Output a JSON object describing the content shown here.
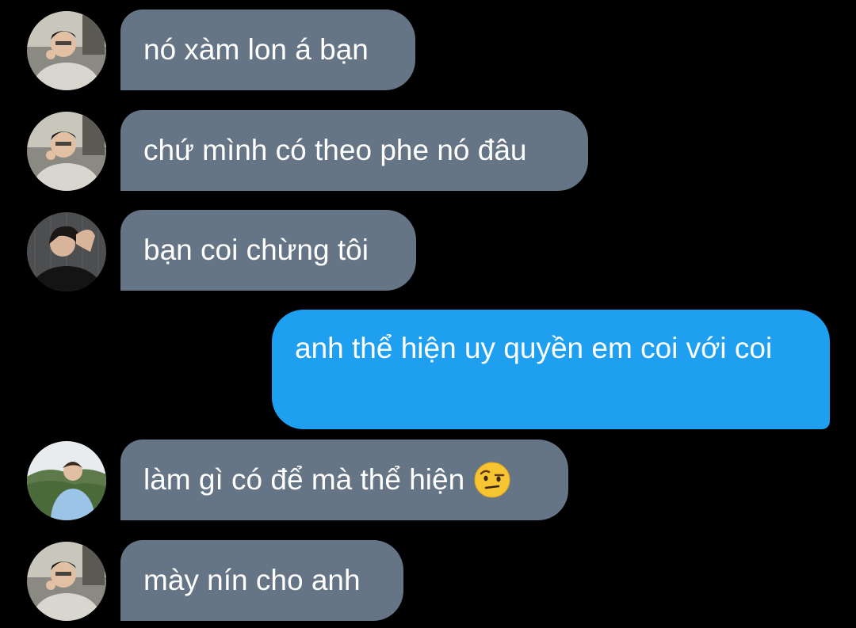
{
  "messages": [
    {
      "sender": "friend_a",
      "direction": "incoming",
      "text": "nó xàm lon á bạn"
    },
    {
      "sender": "friend_a",
      "direction": "incoming",
      "text": "chứ mình có theo phe nó đâu"
    },
    {
      "sender": "friend_b",
      "direction": "incoming",
      "text": "bạn coi chừng tôi"
    },
    {
      "sender": "me",
      "direction": "outgoing",
      "text": "anh thể hiện uy quyền em coi với coi"
    },
    {
      "sender": "friend_c",
      "direction": "incoming",
      "text": "làm gì có để mà thể hiện",
      "emoji": "raised-eyebrow-face"
    },
    {
      "sender": "friend_a",
      "direction": "incoming",
      "text": "mày nín cho anh"
    }
  ],
  "colors": {
    "background": "#000000",
    "incoming_bubble": "#667585",
    "outgoing_bubble": "#1e9ff0",
    "text": "#ffffff"
  }
}
